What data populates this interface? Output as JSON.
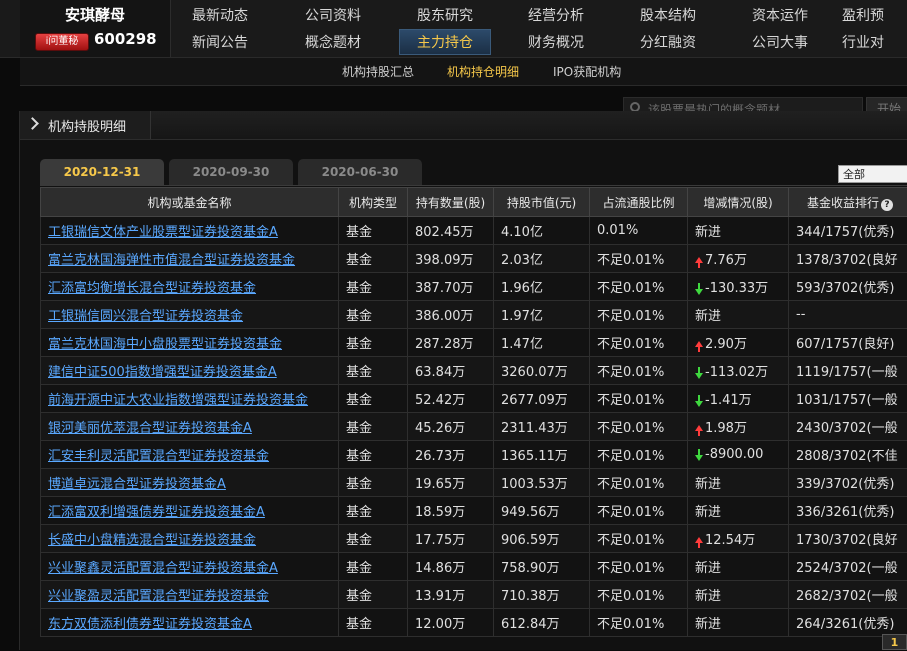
{
  "stock": {
    "name": "安琪酵母",
    "badge": "i问董秘",
    "code": "600298"
  },
  "nav": {
    "row1": [
      "最新动态",
      "公司资料",
      "股东研究",
      "经营分析",
      "股本结构",
      "资本运作",
      "盈利预"
    ],
    "row2": [
      "新闻公告",
      "概念题材",
      "主力持仓",
      "财务概况",
      "分红融资",
      "公司大事",
      "行业对"
    ]
  },
  "subnav": [
    "机构持股汇总",
    "机构持仓明细",
    "IPO获配机构"
  ],
  "search": {
    "placeholder": "该股票最热门的概念题材",
    "button": "开始"
  },
  "panel": {
    "title": "机构持股明细"
  },
  "tabs": [
    "2020-12-31",
    "2020-09-30",
    "2020-06-30"
  ],
  "range_select": "全部",
  "table": {
    "headers": [
      "机构或基金名称",
      "机构类型",
      "持有数量(股)",
      "持股市值(元)",
      "占流通股比例",
      "增减情况(股)",
      "基金收益排行"
    ],
    "rows": [
      {
        "name": "工银瑞信文体产业股票型证券投资基金A",
        "type": "基金",
        "qty": "802.45万",
        "value": "4.10亿",
        "ratio": "0.01%",
        "change": "新进",
        "dir": "none",
        "rank": "344/1757(优秀)"
      },
      {
        "name": "富兰克林国海弹性市值混合型证券投资基金",
        "type": "基金",
        "qty": "398.09万",
        "value": "2.03亿",
        "ratio": "不足0.01%",
        "change": "7.76万",
        "dir": "up",
        "rank": "1378/3702(良好"
      },
      {
        "name": "汇添富均衡增长混合型证券投资基金",
        "type": "基金",
        "qty": "387.70万",
        "value": "1.96亿",
        "ratio": "不足0.01%",
        "change": "-130.33万",
        "dir": "down",
        "rank": "593/3702(优秀)"
      },
      {
        "name": "工银瑞信圆兴混合型证券投资基金",
        "type": "基金",
        "qty": "386.00万",
        "value": "1.97亿",
        "ratio": "不足0.01%",
        "change": "新进",
        "dir": "none",
        "rank": "--"
      },
      {
        "name": "富兰克林国海中小盘股票型证券投资基金",
        "type": "基金",
        "qty": "287.28万",
        "value": "1.47亿",
        "ratio": "不足0.01%",
        "change": "2.90万",
        "dir": "up",
        "rank": "607/1757(良好)"
      },
      {
        "name": "建信中证500指数增强型证券投资基金A",
        "type": "基金",
        "qty": "63.84万",
        "value": "3260.07万",
        "ratio": "不足0.01%",
        "change": "-113.02万",
        "dir": "down",
        "rank": "1119/1757(一般"
      },
      {
        "name": "前海开源中证大农业指数增强型证券投资基金",
        "type": "基金",
        "qty": "52.42万",
        "value": "2677.09万",
        "ratio": "不足0.01%",
        "change": "-1.41万",
        "dir": "down",
        "rank": "1031/1757(一般"
      },
      {
        "name": "银河美丽优萃混合型证券投资基金A",
        "type": "基金",
        "qty": "45.26万",
        "value": "2311.43万",
        "ratio": "不足0.01%",
        "change": "1.98万",
        "dir": "up",
        "rank": "2430/3702(一般"
      },
      {
        "name": "汇安丰利灵活配置混合型证券投资基金",
        "type": "基金",
        "qty": "26.73万",
        "value": "1365.11万",
        "ratio": "不足0.01%",
        "change": "-8900.00",
        "dir": "down",
        "rank": "2808/3702(不佳"
      },
      {
        "name": "博道卓远混合型证券投资基金A",
        "type": "基金",
        "qty": "19.65万",
        "value": "1003.53万",
        "ratio": "不足0.01%",
        "change": "新进",
        "dir": "none",
        "rank": "339/3702(优秀)"
      },
      {
        "name": "汇添富双利增强债券型证券投资基金A",
        "type": "基金",
        "qty": "18.59万",
        "value": "949.56万",
        "ratio": "不足0.01%",
        "change": "新进",
        "dir": "none",
        "rank": "336/3261(优秀)"
      },
      {
        "name": "长盛中小盘精选混合型证券投资基金",
        "type": "基金",
        "qty": "17.75万",
        "value": "906.59万",
        "ratio": "不足0.01%",
        "change": "12.54万",
        "dir": "up",
        "rank": "1730/3702(良好"
      },
      {
        "name": "兴业聚鑫灵活配置混合型证券投资基金A",
        "type": "基金",
        "qty": "14.86万",
        "value": "758.90万",
        "ratio": "不足0.01%",
        "change": "新进",
        "dir": "none",
        "rank": "2524/3702(一般"
      },
      {
        "name": "兴业聚盈灵活配置混合型证券投资基金",
        "type": "基金",
        "qty": "13.91万",
        "value": "710.38万",
        "ratio": "不足0.01%",
        "change": "新进",
        "dir": "none",
        "rank": "2682/3702(一般"
      },
      {
        "name": "东方双债添利债券型证券投资基金A",
        "type": "基金",
        "qty": "12.00万",
        "value": "612.84万",
        "ratio": "不足0.01%",
        "change": "新进",
        "dir": "none",
        "rank": "264/3261(优秀)"
      }
    ]
  },
  "pagination": {
    "current": "1"
  }
}
